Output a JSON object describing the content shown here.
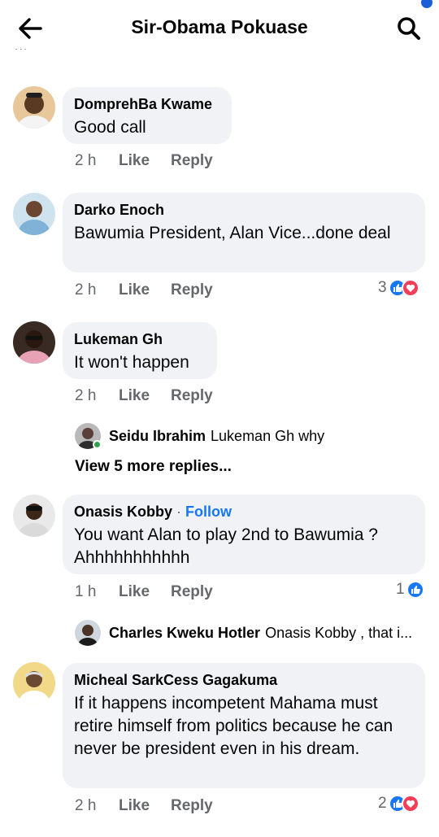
{
  "header": {
    "title": "Sir-Obama Pokuase",
    "truncated_text": "..."
  },
  "comments": [
    {
      "author": "DomprehBa Kwame",
      "text": "Good call",
      "time": "2 h",
      "like_label": "Like",
      "reply_label": "Reply"
    },
    {
      "author": "Darko Enoch",
      "text": "Bawumia President, Alan Vice...done deal",
      "time": "2 h",
      "like_label": "Like",
      "reply_label": "Reply",
      "reactions_count": "3"
    },
    {
      "author": "Lukeman Gh",
      "text": "It won't happen",
      "time": "2 h",
      "like_label": "Like",
      "reply_label": "Reply",
      "reply_preview": {
        "author": "Seidu Ibrahim",
        "text": "Lukeman Gh why"
      },
      "more_replies": "View 5 more replies..."
    },
    {
      "author": "Onasis Kobby",
      "separator": " · ",
      "follow_label": "Follow",
      "text": "You want Alan to play 2nd to Bawumia ? Ahhhhhhhhhhh",
      "time": "1 h",
      "like_label": "Like",
      "reply_label": "Reply",
      "reactions_count": "1",
      "reply_preview": {
        "author": "Charles Kweku Hotler",
        "text": "Onasis Kobby , that i..."
      }
    },
    {
      "author": "Micheal SarkCess Gagakuma",
      "text": "If it happens incompetent Mahama must retire himself from politics because he can never be president even in his dream.",
      "time": "2 h",
      "like_label": "Like",
      "reply_label": "Reply",
      "reactions_count": "2"
    }
  ],
  "colors": {
    "bubble": "#f0f2f5",
    "like_blue": "#1877f2",
    "love_red": "#f33e58",
    "meta_gray": "#65676b"
  }
}
